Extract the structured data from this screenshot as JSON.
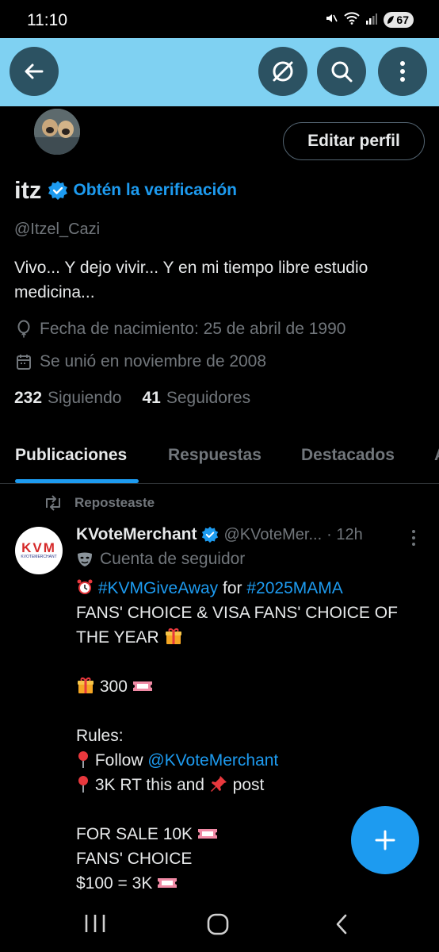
{
  "status_bar": {
    "time": "11:10",
    "battery": "67",
    "icons": [
      "mute-icon",
      "wifi-icon",
      "signal-icon",
      "battery-icon"
    ]
  },
  "header": {
    "banner_color": "#7fd1f2",
    "buttons": [
      "back-arrow-icon",
      "grok-icon",
      "search-icon",
      "more-vertical-icon"
    ]
  },
  "profile": {
    "edit_button": "Editar perfil",
    "name": "itz",
    "verify_link": "Obtén la verificación",
    "handle": "@Itzel_Cazi",
    "bio_line1": "Vivo... Y dejo vivir... Y en mi tiempo libre estudio",
    "bio_line2": "medicina...",
    "birthday": "Fecha de nacimiento: 25 de abril de 1990",
    "joined": "Se unió en noviembre de 2008",
    "following_count": "232",
    "following_label": "Siguiendo",
    "followers_count": "41",
    "followers_label": "Seguidores"
  },
  "tabs": {
    "t0": "Publicaciones",
    "t1": "Respuestas",
    "t2": "Destacados",
    "t3": "A",
    "active": 0
  },
  "post": {
    "repost_label": "Reposteaste",
    "avatar_text": "KVM",
    "avatar_subtext": "KVOTEMERCHANT",
    "author": "KVoteMerchant",
    "handle": "@KVoteMer...",
    "time": "· 12h",
    "follower_label": "Cuenta de seguidor",
    "hashtag1": "#KVMGiveAway",
    "for_word": " for ",
    "hashtag2": "#2025MAMA",
    "line2": "FANS' CHOICE & VISA FANS' CHOICE OF",
    "line3": "THE YEAR",
    "prize_amount": " 300",
    "rules_label": "Rules:",
    "follow_word": " Follow ",
    "mention": "@KVoteMerchant",
    "rt_text_a": " 3K RT this and ",
    "rt_text_b": " post",
    "sale_line": "FOR SALE 10K",
    "fans_choice": "FANS' CHOICE",
    "price_line": "$100 = 3K"
  },
  "fab": {
    "icon": "plus-icon",
    "color": "#1d9bf0"
  },
  "nav": [
    "recents-icon",
    "home-icon",
    "back-icon"
  ]
}
